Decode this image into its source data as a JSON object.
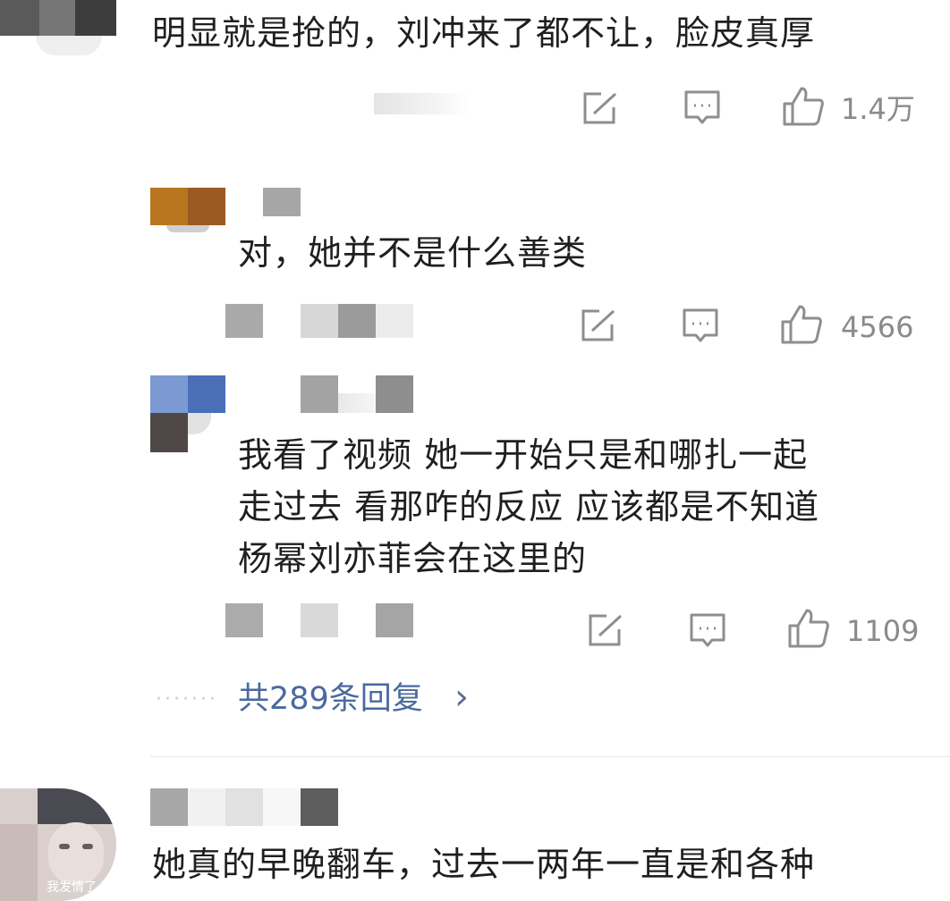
{
  "comments": [
    {
      "text": "明显就是抢的，刘冲来了都不让，脸皮真厚",
      "likes": "1.4万"
    },
    {
      "text": "对，她并不是什么善类",
      "likes": "4566"
    },
    {
      "lines": [
        "我看了视频 她一开始只是和哪扎一起",
        "走过去 看那咋的反应 应该都是不知道",
        "杨幂刘亦菲会在这里的"
      ],
      "likes": "1109"
    },
    {
      "text": "她真的早晚翻车，过去一两年一直是和各种"
    }
  ],
  "replies": {
    "dots": "·······",
    "label": "共289条回复",
    "chevron": "›"
  },
  "watermark": "我发情了 路"
}
